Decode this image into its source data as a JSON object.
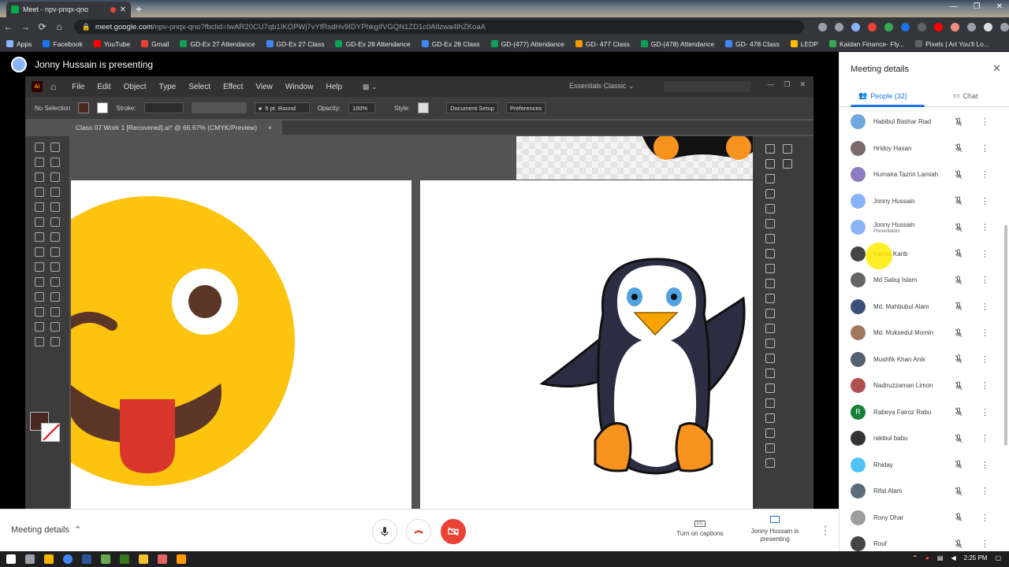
{
  "browser": {
    "tab_title": "Meet - npv-pnqx-qno",
    "new_tab_symbol": "+",
    "url_host": "meet.google.com",
    "url_path": "/npv-pnqx-qno?fbclid=IwAR20CU7qb1IKOPWj7vYfRsdHv9IDYPhkgIfVGQN1ZD1c0AIlzwa4lhZKoaA",
    "bookmarks": [
      {
        "label": "Apps",
        "color": "#8ab4f8"
      },
      {
        "label": "Facebook",
        "color": "#1877f2"
      },
      {
        "label": "YouTube",
        "color": "#ff0000"
      },
      {
        "label": "Gmail",
        "color": "#ea4335"
      },
      {
        "label": "GD-Ex 27 Attendance",
        "color": "#0f9d58"
      },
      {
        "label": "GD-Ex 27 Class",
        "color": "#4285f4"
      },
      {
        "label": "GD-Ex 28 Attendance",
        "color": "#0f9d58"
      },
      {
        "label": "GD-Ex 28 Class",
        "color": "#4285f4"
      },
      {
        "label": "GD-(477) Attendance",
        "color": "#0f9d58"
      },
      {
        "label": "GD- 477 Class",
        "color": "#f29900"
      },
      {
        "label": "GD-(478) Attendance",
        "color": "#0f9d58"
      },
      {
        "label": "GD- 478 Class",
        "color": "#4285f4"
      },
      {
        "label": "LEDP",
        "color": "#fbbc04"
      },
      {
        "label": "Kaidan Finance- Fly...",
        "color": "#34a853"
      },
      {
        "label": "Pixels | Art You'll Lo...",
        "color": "#5f6368"
      }
    ]
  },
  "meet": {
    "presenting_banner": "Jonny Hussain is presenting",
    "meeting_details_label": "Meeting details",
    "captions_label": "Turn on captions",
    "captions_icon_text": "CC",
    "presenting_label": "Jonny Hussain is presenting"
  },
  "illustrator": {
    "logo_text": "Ai",
    "menus": [
      "File",
      "Edit",
      "Object",
      "Type",
      "Select",
      "Effect",
      "View",
      "Window",
      "Help"
    ],
    "workspace": "Essentials Classic",
    "control_bar": {
      "selection": "No Selection",
      "stroke_label": "Stroke:",
      "brush": "5 pt. Round",
      "opacity_label": "Opacity:",
      "opacity_value": "100%",
      "style_label": "Style:",
      "doc_setup": "Document Setup",
      "preferences": "Preferences"
    },
    "document_tab": "Class 07 Work 1 [Recovered].ai* @ 66.67% (CMYK/Preview)",
    "document_tab_close": "×"
  },
  "side_panel": {
    "title": "Meeting details",
    "tabs": {
      "people": "People (32)",
      "chat": "Chat"
    },
    "participants": [
      {
        "name": "Habibul Bashar Riad",
        "sub": "",
        "avatar": "#6fa8dc",
        "letter": ""
      },
      {
        "name": "Hridoy Hasan",
        "sub": "",
        "avatar": "#7a6a6a",
        "letter": ""
      },
      {
        "name": "Humaira Tazrin Lamiah",
        "sub": "",
        "avatar": "#8e7cc3",
        "letter": ""
      },
      {
        "name": "Jonny Hussain",
        "sub": "",
        "avatar": "#8ab4f8",
        "letter": ""
      },
      {
        "name": "Jonny Hussain",
        "sub": "Presentation",
        "avatar": "#8ab4f8",
        "letter": ""
      },
      {
        "name": "Kamal Karib",
        "sub": "",
        "avatar": "#444444",
        "letter": ""
      },
      {
        "name": "Md Sabuj Islam",
        "sub": "",
        "avatar": "#666666",
        "letter": ""
      },
      {
        "name": "Md. Mahbubul Alam",
        "sub": "",
        "avatar": "#3d4f7a",
        "letter": ""
      },
      {
        "name": "Md. Muksedul Momin",
        "sub": "",
        "avatar": "#a07860",
        "letter": ""
      },
      {
        "name": "Mushfik Khan Anik",
        "sub": "",
        "avatar": "#556070",
        "letter": ""
      },
      {
        "name": "Nadiruzzaman Limon",
        "sub": "",
        "avatar": "#b05050",
        "letter": ""
      },
      {
        "name": "Rabeya Fairoz Rabu",
        "sub": "",
        "avatar": "#188038",
        "letter": "R"
      },
      {
        "name": "rakibul babu",
        "sub": "",
        "avatar": "#333333",
        "letter": ""
      },
      {
        "name": "Rhiday",
        "sub": "",
        "avatar": "#4fc3f7",
        "letter": ""
      },
      {
        "name": "Rifat Alam",
        "sub": "",
        "avatar": "#5c6b7a",
        "letter": ""
      },
      {
        "name": "Rony Dhar",
        "sub": "",
        "avatar": "#9e9e9e",
        "letter": ""
      },
      {
        "name": "Rouf",
        "sub": "",
        "avatar": "#444444",
        "letter": ""
      }
    ]
  },
  "taskbar": {
    "time": "2:25 PM"
  }
}
